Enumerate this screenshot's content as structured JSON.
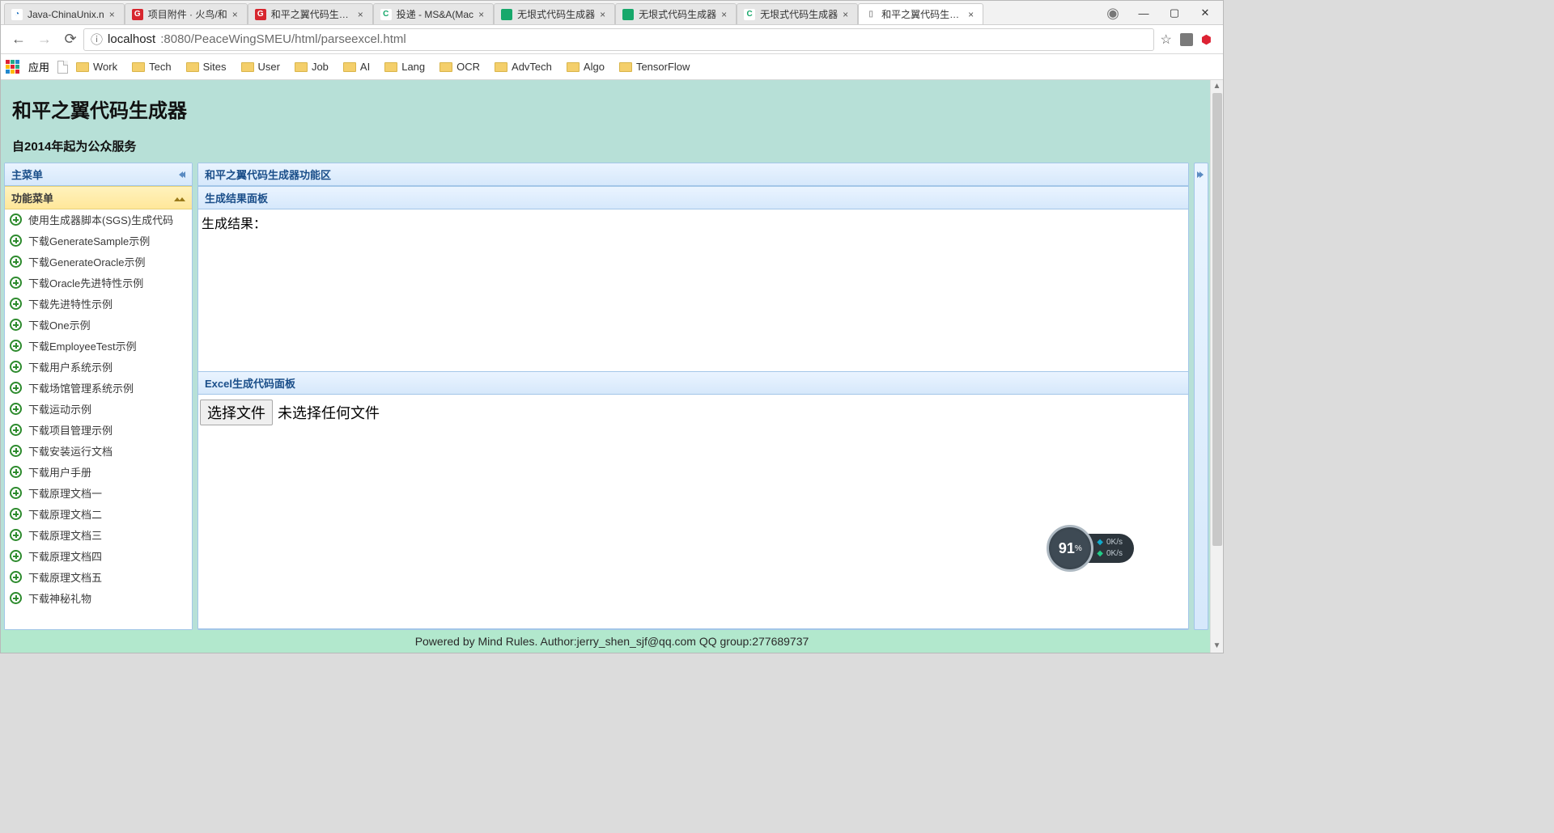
{
  "browser": {
    "tabs": [
      {
        "title": "Java-ChinaUnix.n",
        "favicon_bg": "#fff",
        "favicon_fg": "#1e70bf",
        "favicon_txt": "◔"
      },
      {
        "title": "项目附件 · 火鸟/和",
        "favicon_bg": "#d7262e",
        "favicon_fg": "#fff",
        "favicon_txt": "G"
      },
      {
        "title": "和平之翼代码生成器",
        "favicon_bg": "#d7262e",
        "favicon_fg": "#fff",
        "favicon_txt": "G"
      },
      {
        "title": "投递 - MS&A(Mac",
        "favicon_bg": "#fff",
        "favicon_fg": "#17a86b",
        "favicon_txt": "C"
      },
      {
        "title": "无垠式代码生成器",
        "favicon_bg": "#17a86b",
        "favicon_fg": "#fff",
        "favicon_txt": "</>"
      },
      {
        "title": "无垠式代码生成器",
        "favicon_bg": "#17a86b",
        "favicon_fg": "#fff",
        "favicon_txt": "</>"
      },
      {
        "title": "无垠式代码生成器",
        "favicon_bg": "#fff",
        "favicon_fg": "#17a86b",
        "favicon_txt": "C"
      },
      {
        "title": "和平之翼代码生成器",
        "favicon_bg": "#fff",
        "favicon_fg": "#999",
        "favicon_txt": "▯",
        "active": true
      }
    ],
    "url_host": "localhost",
    "url_port_path": ":8080/PeaceWingSMEU/html/parseexcel.html",
    "info_glyph": "ⓘ",
    "bookmarks_label": "应用",
    "bookmarks": [
      "Work",
      "Tech",
      "Sites",
      "User",
      "Job",
      "AI",
      "Lang",
      "OCR",
      "AdvTech",
      "Algo",
      "TensorFlow"
    ]
  },
  "page": {
    "title": "和平之翼代码生成器",
    "subtitle": "自2014年起为公众服务",
    "left_panel_title": "主菜单",
    "left_group_title": "功能菜单",
    "menu_items": [
      "使用生成器脚本(SGS)生成代码",
      "下载GenerateSample示例",
      "下载GenerateOracle示例",
      "下载Oracle先进特性示例",
      "下载先进特性示例",
      "下载One示例",
      "下载EmployeeTest示例",
      "下载用户系统示例",
      "下载场馆管理系统示例",
      "下载运动示例",
      "下载项目管理示例",
      "下载安装运行文档",
      "下载用户手册",
      "下载原理文档一",
      "下载原理文档二",
      "下载原理文档三",
      "下载原理文档四",
      "下载原理文档五",
      "下载神秘礼物"
    ],
    "main_panel_title": "和平之翼代码生成器功能区",
    "result_panel_title": "生成结果面板",
    "result_label": "生成结果：",
    "excel_panel_title": "Excel生成代码面板",
    "file_button": "选择文件",
    "file_status": "未选择任何文件",
    "footer": "Powered by Mind Rules. Author:jerry_shen_sjf@qq.com QQ group:277689737"
  },
  "widget": {
    "gauge_value": "91",
    "gauge_unit": "%",
    "up_rate": "0K/s",
    "down_rate": "0K/s"
  }
}
